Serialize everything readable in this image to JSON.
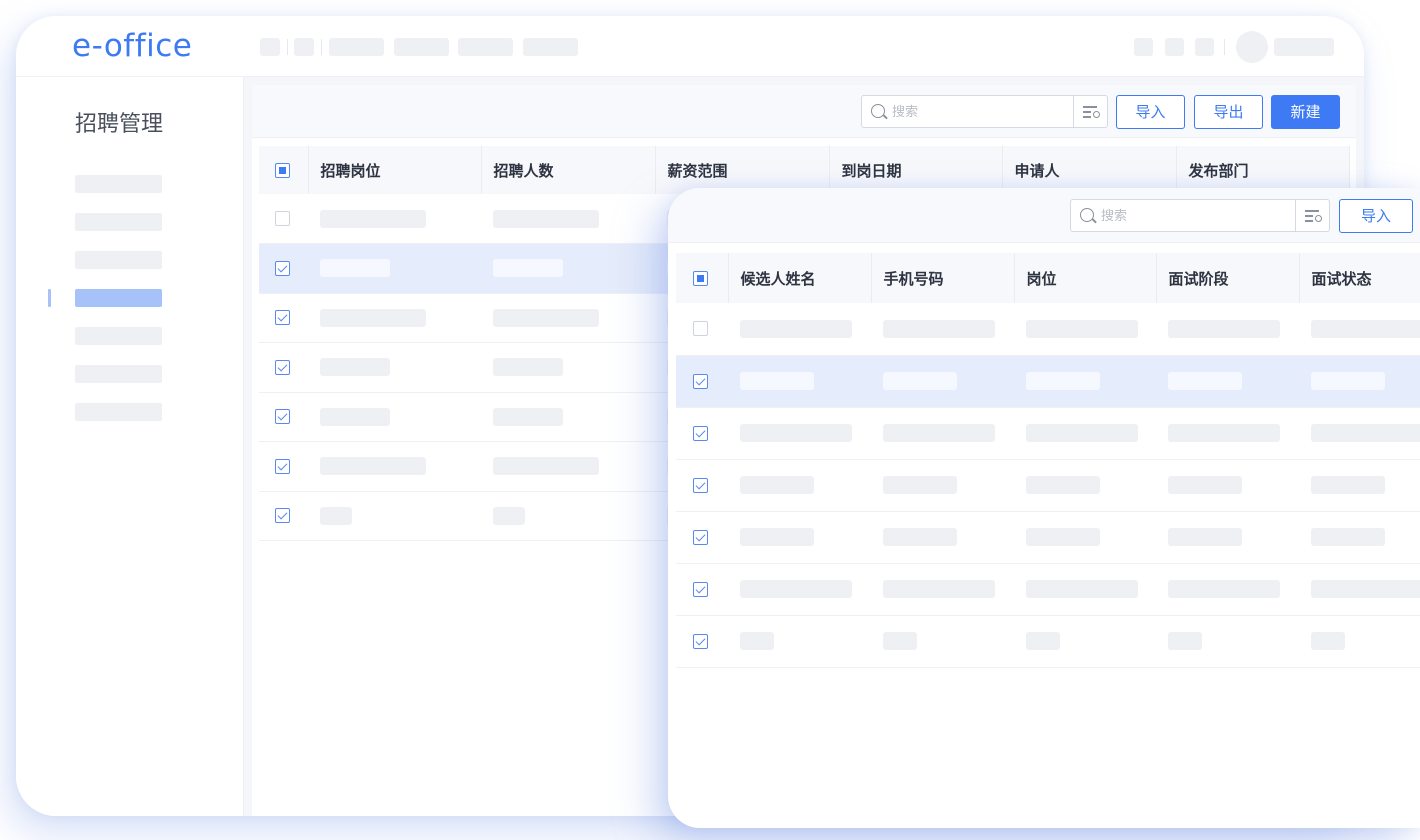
{
  "app": {
    "logo": "e-office",
    "section_title": "招聘管理"
  },
  "toolbar": {
    "search_placeholder": "搜索",
    "import_label": "导入",
    "export_label": "导出",
    "new_label": "新建"
  },
  "back_table": {
    "columns": [
      "招聘岗位",
      "招聘人数",
      "薪资范围",
      "到岗日期",
      "申请人",
      "发布部门"
    ],
    "rows": [
      {
        "checked": false,
        "selected": false
      },
      {
        "checked": true,
        "selected": true
      },
      {
        "checked": true,
        "selected": false
      },
      {
        "checked": true,
        "selected": false
      },
      {
        "checked": true,
        "selected": false
      },
      {
        "checked": true,
        "selected": false
      },
      {
        "checked": true,
        "selected": false
      }
    ]
  },
  "front_toolbar": {
    "search_placeholder": "搜索",
    "import_label": "导入"
  },
  "front_table": {
    "columns": [
      "候选人姓名",
      "手机号码",
      "岗位",
      "面试阶段",
      "面试状态"
    ],
    "rows": [
      {
        "checked": false,
        "selected": false
      },
      {
        "checked": true,
        "selected": true
      },
      {
        "checked": true,
        "selected": false
      },
      {
        "checked": true,
        "selected": false
      },
      {
        "checked": true,
        "selected": false
      },
      {
        "checked": true,
        "selected": false
      },
      {
        "checked": true,
        "selected": false
      }
    ]
  },
  "colors": {
    "accent": "#3d7af3",
    "selected_row": "#e5ecfb",
    "placeholder": "#eff0f4"
  }
}
